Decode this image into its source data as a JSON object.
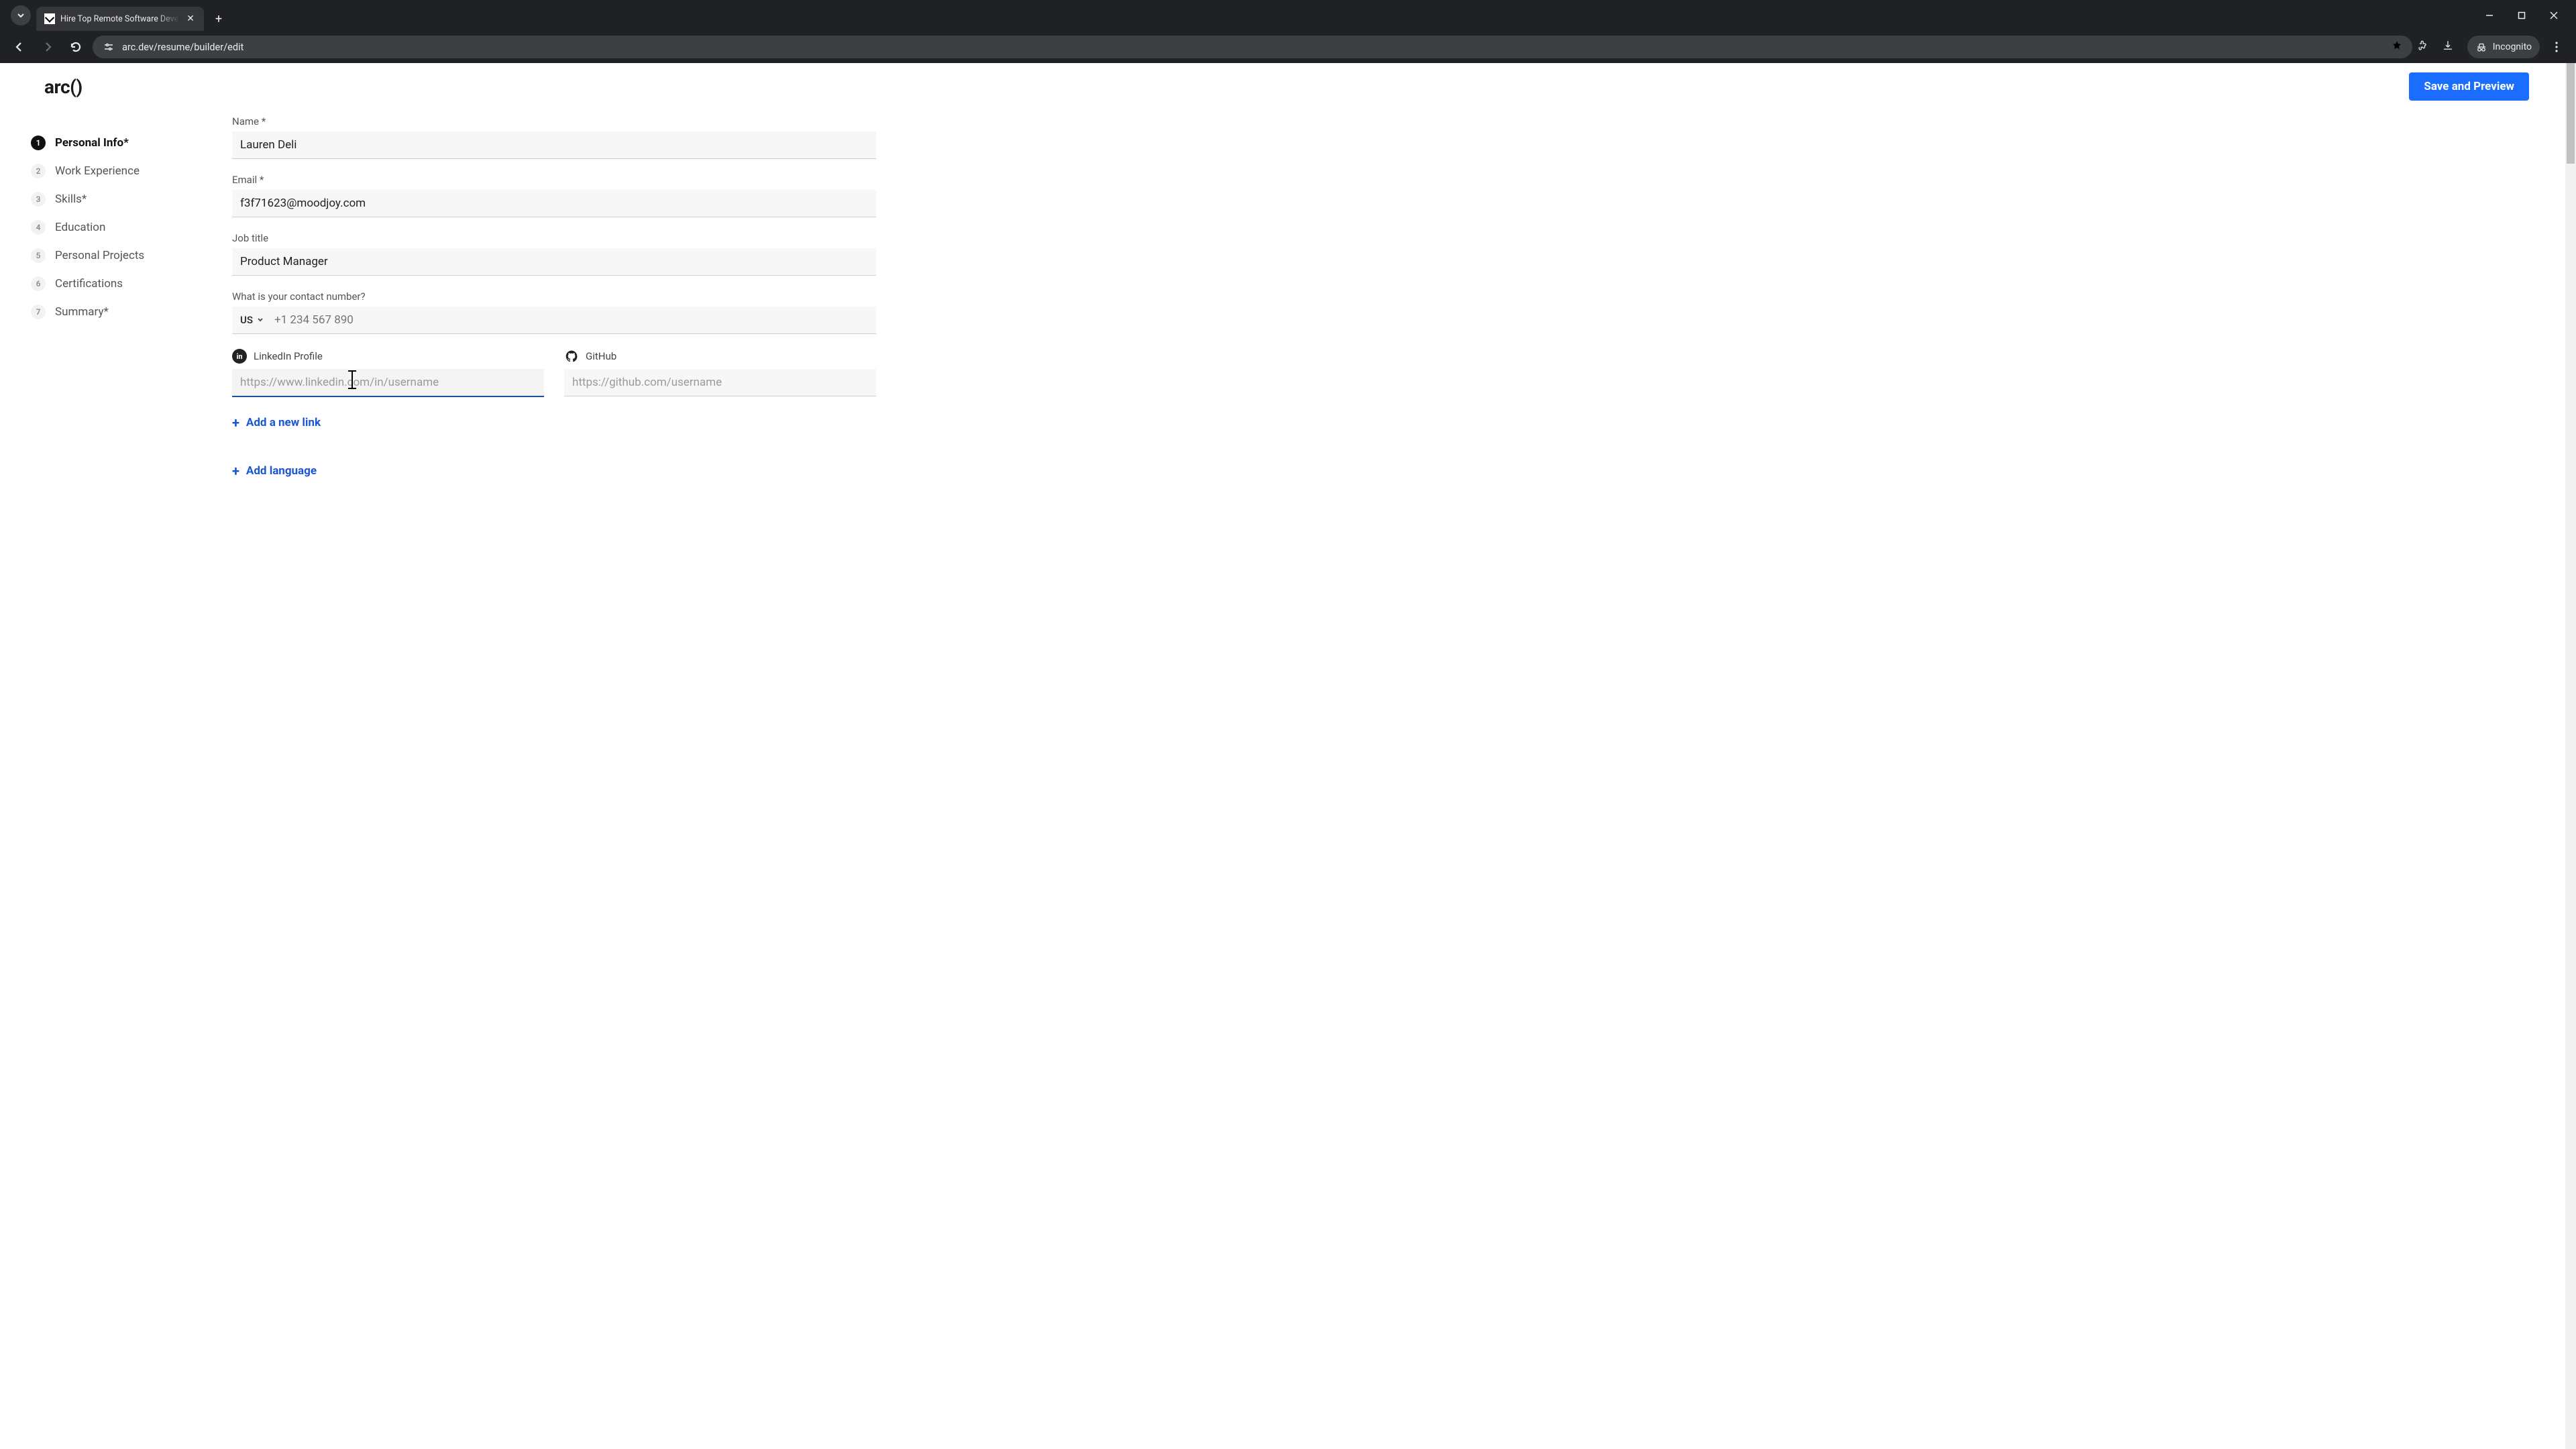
{
  "browser": {
    "tab_title": "Hire Top Remote Software Deve",
    "url": "arc.dev/resume/builder/edit",
    "incognito_label": "Incognito"
  },
  "header": {
    "logo": "arc()",
    "save_button": "Save and Preview"
  },
  "sidebar": {
    "items": [
      {
        "num": "1",
        "label": "Personal Info*",
        "active": true
      },
      {
        "num": "2",
        "label": "Work Experience",
        "active": false
      },
      {
        "num": "3",
        "label": "Skills*",
        "active": false
      },
      {
        "num": "4",
        "label": "Education",
        "active": false
      },
      {
        "num": "5",
        "label": "Personal Projects",
        "active": false
      },
      {
        "num": "6",
        "label": "Certifications",
        "active": false
      },
      {
        "num": "7",
        "label": "Summary*",
        "active": false
      }
    ]
  },
  "form": {
    "name_label": "Name *",
    "name_value": "Lauren Deli",
    "email_label": "Email *",
    "email_value": "f3f71623@moodjoy.com",
    "jobtitle_label": "Job title",
    "jobtitle_value": "Product Manager",
    "contact_label": "What is your contact number?",
    "country_code": "US",
    "phone_placeholder": "+1 234 567 890",
    "linkedin_label": "LinkedIn Profile",
    "linkedin_placeholder": "https://www.linkedin.com/in/username",
    "github_label": "GitHub",
    "github_placeholder": "https://github.com/username",
    "add_link_label": "Add a new link",
    "add_language_label": "Add language"
  }
}
